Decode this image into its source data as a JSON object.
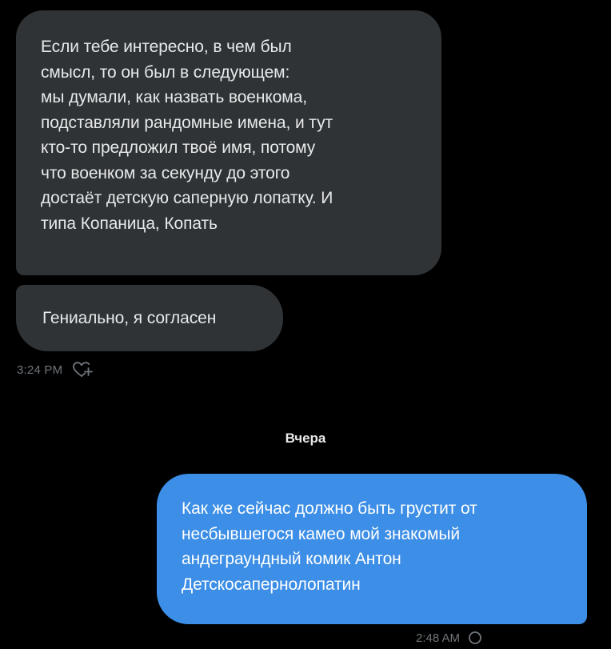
{
  "conversation": {
    "messages": [
      {
        "direction": "incoming",
        "lines": [
          "Если тебе интересно, в чем был",
          "смысл, то он был в следующем:",
          "мы думали, как назвать военкома,",
          "подставляли рандомные имена, и тут",
          "кто-то предложил твоё имя, потому",
          "что военком за секунду до этого",
          "достаёт детскую саперную лопатку. И",
          "типа Копаница, Копать"
        ]
      },
      {
        "direction": "incoming",
        "lines": [
          "Гениально, я согласен"
        ]
      },
      {
        "direction": "outgoing",
        "lines": [
          "Как же сейчас должно быть грустит от",
          "несбывшегося камео мой знакомый",
          "андеграундный комик Антон",
          "Детскосапернолопатин"
        ]
      }
    ],
    "incoming_meta": {
      "time": "3:24 PM",
      "icon": "add-reaction-heart-icon"
    },
    "date_divider": "Вчера",
    "outgoing_meta": {
      "time": "2:48 AM",
      "icon": "sent-status-icon"
    }
  },
  "colors": {
    "background": "#000000",
    "incoming_bubble": "#2f3336",
    "outgoing_bubble": "#3c8ee6",
    "meta_text": "#71767b"
  }
}
